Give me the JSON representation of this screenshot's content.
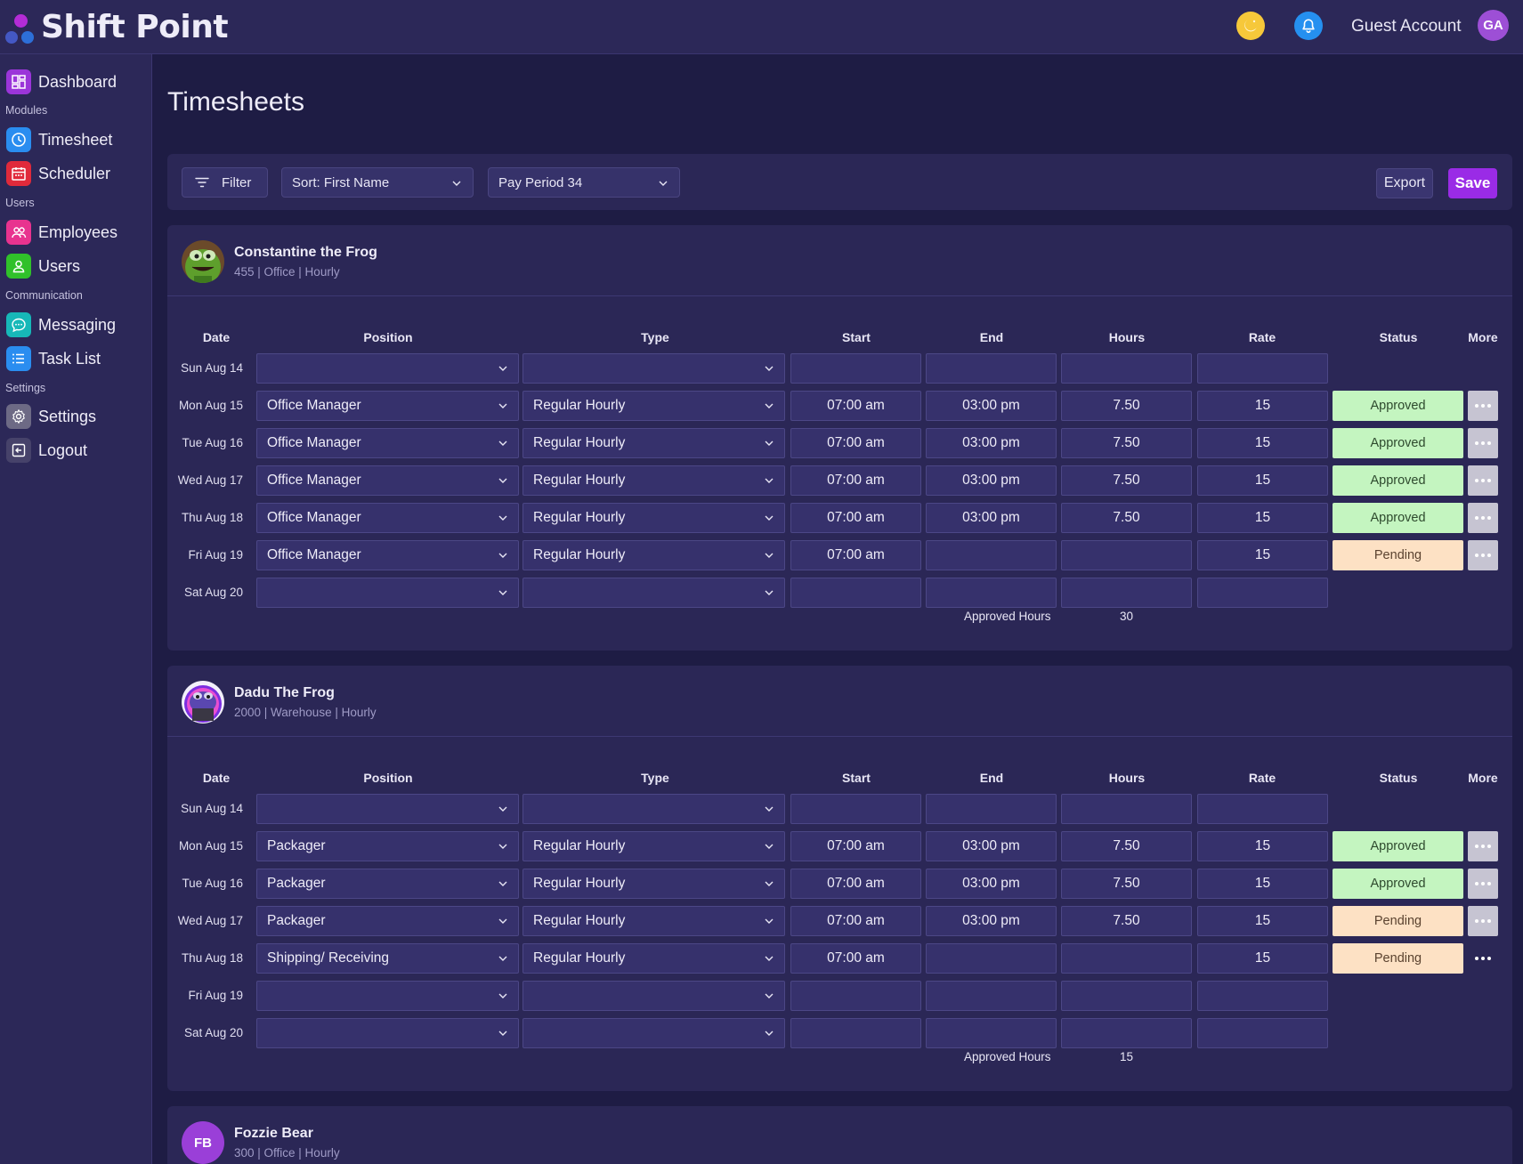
{
  "app": {
    "name": "Shift Point"
  },
  "header": {
    "user_name": "Guest Account",
    "user_initials": "GA"
  },
  "sidebar": {
    "dashboard": "Dashboard",
    "section_modules": "Modules",
    "timesheet": "Timesheet",
    "scheduler": "Scheduler",
    "section_users": "Users",
    "employees": "Employees",
    "users": "Users",
    "section_communication": "Communication",
    "messaging": "Messaging",
    "task_list": "Task List",
    "section_settings": "Settings",
    "settings": "Settings",
    "logout": "Logout"
  },
  "page": {
    "title": "Timesheets"
  },
  "toolbar": {
    "filter_label": "Filter",
    "sort_value": "Sort: First Name",
    "pay_period_value": "Pay Period 34",
    "export_label": "Export",
    "save_label": "Save"
  },
  "columns": {
    "date": "Date",
    "position": "Position",
    "type": "Type",
    "start": "Start",
    "end": "End",
    "hours": "Hours",
    "rate": "Rate",
    "status": "Status",
    "more": "More"
  },
  "approved_hours_label": "Approved Hours",
  "colors": {
    "accent": "#9a2be6",
    "approved": "#c4f5c0",
    "pending": "#fde1c4"
  },
  "employees": [
    {
      "name": "Constantine the Frog",
      "meta": "455 | Office | Hourly",
      "avatar": "frog-green",
      "approved_hours": "30",
      "rows": [
        {
          "date": "Sun Aug 14",
          "position": "",
          "type": "",
          "start": "",
          "end": "",
          "hours": "",
          "rate": "",
          "status": "",
          "more": ""
        },
        {
          "date": "Mon Aug 15",
          "position": "Office Manager",
          "type": "Regular Hourly",
          "start": "07:00 am",
          "end": "03:00 pm",
          "hours": "7.50",
          "rate": "15",
          "status": "Approved",
          "more": "filled"
        },
        {
          "date": "Tue Aug 16",
          "position": "Office Manager",
          "type": "Regular Hourly",
          "start": "07:00 am",
          "end": "03:00 pm",
          "hours": "7.50",
          "rate": "15",
          "status": "Approved",
          "more": "filled"
        },
        {
          "date": "Wed Aug 17",
          "position": "Office Manager",
          "type": "Regular Hourly",
          "start": "07:00 am",
          "end": "03:00 pm",
          "hours": "7.50",
          "rate": "15",
          "status": "Approved",
          "more": "filled"
        },
        {
          "date": "Thu Aug 18",
          "position": "Office Manager",
          "type": "Regular Hourly",
          "start": "07:00 am",
          "end": "03:00 pm",
          "hours": "7.50",
          "rate": "15",
          "status": "Approved",
          "more": "filled"
        },
        {
          "date": "Fri Aug 19",
          "position": "Office Manager",
          "type": "Regular Hourly",
          "start": "07:00 am",
          "end": "",
          "hours": "",
          "rate": "15",
          "status": "Pending",
          "more": "filled"
        },
        {
          "date": "Sat Aug 20",
          "position": "",
          "type": "",
          "start": "",
          "end": "",
          "hours": "",
          "rate": "",
          "status": "",
          "more": ""
        }
      ]
    },
    {
      "name": "Dadu The Frog",
      "meta": "2000 | Warehouse | Hourly",
      "avatar": "frog-purple",
      "approved_hours": "15",
      "rows": [
        {
          "date": "Sun Aug 14",
          "position": "",
          "type": "",
          "start": "",
          "end": "",
          "hours": "",
          "rate": "",
          "status": "",
          "more": ""
        },
        {
          "date": "Mon Aug 15",
          "position": "Packager",
          "type": "Regular Hourly",
          "start": "07:00 am",
          "end": "03:00 pm",
          "hours": "7.50",
          "rate": "15",
          "status": "Approved",
          "more": "filled"
        },
        {
          "date": "Tue Aug 16",
          "position": "Packager",
          "type": "Regular Hourly",
          "start": "07:00 am",
          "end": "03:00 pm",
          "hours": "7.50",
          "rate": "15",
          "status": "Approved",
          "more": "filled"
        },
        {
          "date": "Wed Aug 17",
          "position": "Packager",
          "type": "Regular Hourly",
          "start": "07:00 am",
          "end": "03:00 pm",
          "hours": "7.50",
          "rate": "15",
          "status": "Pending",
          "more": "filled"
        },
        {
          "date": "Thu Aug 18",
          "position": "Shipping/ Receiving",
          "type": "Regular Hourly",
          "start": "07:00 am",
          "end": "",
          "hours": "",
          "rate": "15",
          "status": "Pending",
          "more": "plain"
        },
        {
          "date": "Fri Aug 19",
          "position": "",
          "type": "",
          "start": "",
          "end": "",
          "hours": "",
          "rate": "",
          "status": "",
          "more": ""
        },
        {
          "date": "Sat Aug 20",
          "position": "",
          "type": "",
          "start": "",
          "end": "",
          "hours": "",
          "rate": "",
          "status": "",
          "more": ""
        }
      ]
    },
    {
      "name": "Fozzie Bear",
      "meta": "300 | Office | Hourly",
      "initials": "FB"
    }
  ]
}
